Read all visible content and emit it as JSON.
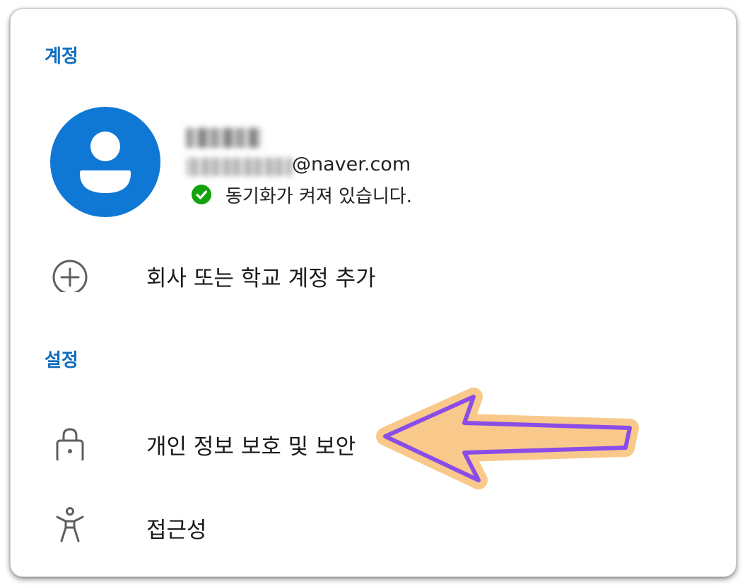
{
  "sections": {
    "account_header": "계정",
    "settings_header": "설정"
  },
  "account": {
    "email_suffix": "@naver.com",
    "sync_status": "동기화가 켜져 있습니다."
  },
  "actions": {
    "add_account": "회사 또는 학교 계정 추가"
  },
  "settings": {
    "items": [
      {
        "label": "개인 정보 보호 및 보안",
        "icon": "lock-icon"
      },
      {
        "label": "접근성",
        "icon": "accessibility-icon"
      }
    ]
  },
  "colors": {
    "accent": "#0f6cbd",
    "avatar": "#0f78d4",
    "sync_ok": "#13a10e",
    "arrow_fill": "#f9c98b",
    "arrow_stroke": "#8a4de8"
  }
}
